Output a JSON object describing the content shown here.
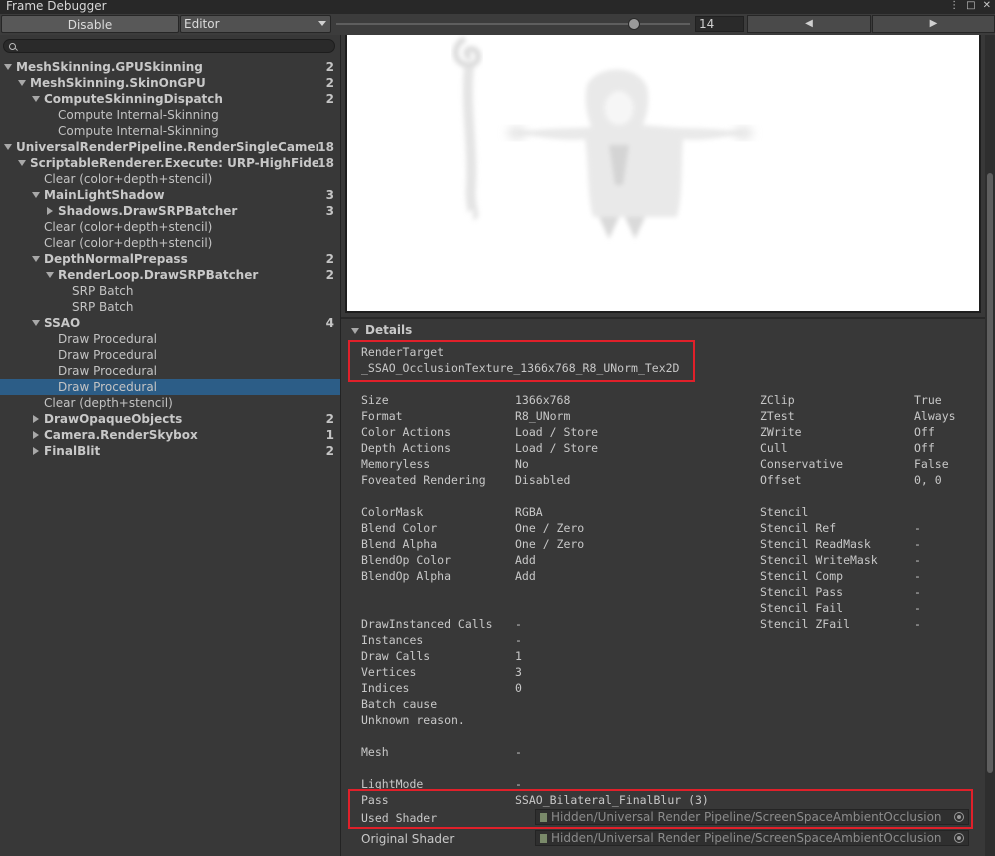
{
  "window": {
    "title": "Frame Debugger",
    "icons": [
      "more-icon",
      "maximize-icon",
      "close-icon"
    ]
  },
  "toolbar": {
    "disable_label": "Disable",
    "editor_label": "Editor",
    "step_value": "14",
    "step_level": 0.84,
    "prev_label": "◀",
    "next_label": "▶"
  },
  "tree": {
    "items": [
      {
        "label": "MeshSkinning.GPUSkinning",
        "count": "2",
        "depth": 0,
        "fold": "open",
        "bold": true
      },
      {
        "label": "MeshSkinning.SkinOnGPU",
        "count": "2",
        "depth": 1,
        "fold": "open",
        "bold": true
      },
      {
        "label": "ComputeSkinningDispatch",
        "count": "2",
        "depth": 2,
        "fold": "open",
        "bold": true
      },
      {
        "label": "Compute Internal-Skinning",
        "count": "",
        "depth": 3,
        "fold": "",
        "bold": false
      },
      {
        "label": "Compute Internal-Skinning",
        "count": "",
        "depth": 3,
        "fold": "",
        "bold": false
      },
      {
        "label": "UniversalRenderPipeline.RenderSingleCameraInterr",
        "count": "18",
        "depth": 0,
        "fold": "open",
        "bold": true
      },
      {
        "label": "ScriptableRenderer.Execute: URP-HighFidelity-R",
        "count": "18",
        "depth": 1,
        "fold": "open",
        "bold": true
      },
      {
        "label": "Clear (color+depth+stencil)",
        "count": "",
        "depth": 2,
        "fold": "",
        "bold": false
      },
      {
        "label": "MainLightShadow",
        "count": "3",
        "depth": 2,
        "fold": "open",
        "bold": true
      },
      {
        "label": "Shadows.DrawSRPBatcher",
        "count": "3",
        "depth": 3,
        "fold": "closed",
        "bold": true
      },
      {
        "label": "Clear (color+depth+stencil)",
        "count": "",
        "depth": 2,
        "fold": "",
        "bold": false
      },
      {
        "label": "Clear (color+depth+stencil)",
        "count": "",
        "depth": 2,
        "fold": "",
        "bold": false
      },
      {
        "label": "DepthNormalPrepass",
        "count": "2",
        "depth": 2,
        "fold": "open",
        "bold": true
      },
      {
        "label": "RenderLoop.DrawSRPBatcher",
        "count": "2",
        "depth": 3,
        "fold": "open",
        "bold": true
      },
      {
        "label": "SRP Batch",
        "count": "",
        "depth": 4,
        "fold": "",
        "bold": false
      },
      {
        "label": "SRP Batch",
        "count": "",
        "depth": 4,
        "fold": "",
        "bold": false
      },
      {
        "label": "SSAO",
        "count": "4",
        "depth": 2,
        "fold": "open",
        "bold": true
      },
      {
        "label": "Draw Procedural",
        "count": "",
        "depth": 3,
        "fold": "",
        "bold": false
      },
      {
        "label": "Draw Procedural",
        "count": "",
        "depth": 3,
        "fold": "",
        "bold": false
      },
      {
        "label": "Draw Procedural",
        "count": "",
        "depth": 3,
        "fold": "",
        "bold": false
      },
      {
        "label": "Draw Procedural",
        "count": "",
        "depth": 3,
        "fold": "",
        "bold": false,
        "selected": true
      },
      {
        "label": "Clear (depth+stencil)",
        "count": "",
        "depth": 2,
        "fold": "",
        "bold": false
      },
      {
        "label": "DrawOpaqueObjects",
        "count": "2",
        "depth": 2,
        "fold": "closed",
        "bold": true
      },
      {
        "label": "Camera.RenderSkybox",
        "count": "1",
        "depth": 2,
        "fold": "closed",
        "bold": true
      },
      {
        "label": "FinalBlit",
        "count": "2",
        "depth": 2,
        "fold": "closed",
        "bold": true
      }
    ]
  },
  "details": {
    "header": "Details",
    "render_target_label": "RenderTarget",
    "render_target_value": "_SSAO_OcclusionTexture_1366x768_R8_UNorm_Tex2D",
    "col1": [
      {
        "k": "Size",
        "v": "1366x768"
      },
      {
        "k": "Format",
        "v": "R8_UNorm"
      },
      {
        "k": "Color Actions",
        "v": "Load / Store"
      },
      {
        "k": "Depth Actions",
        "v": "Load / Store"
      },
      {
        "k": "Memoryless",
        "v": "No"
      },
      {
        "k": "Foveated Rendering",
        "v": "Disabled"
      },
      {
        "k": "",
        "v": ""
      },
      {
        "k": "ColorMask",
        "v": "RGBA"
      },
      {
        "k": "Blend Color",
        "v": "One / Zero"
      },
      {
        "k": "Blend Alpha",
        "v": "One / Zero"
      },
      {
        "k": "BlendOp Color",
        "v": "Add"
      },
      {
        "k": "BlendOp Alpha",
        "v": "Add"
      },
      {
        "k": "",
        "v": ""
      },
      {
        "k": "",
        "v": ""
      },
      {
        "k": "DrawInstanced Calls",
        "v": "-"
      },
      {
        "k": "Instances",
        "v": "-"
      },
      {
        "k": "Draw Calls",
        "v": "1"
      },
      {
        "k": "Vertices",
        "v": "3"
      },
      {
        "k": "Indices",
        "v": "0"
      }
    ],
    "col2": [
      {
        "k": "ZClip",
        "v": "True"
      },
      {
        "k": "ZTest",
        "v": "Always"
      },
      {
        "k": "ZWrite",
        "v": "Off"
      },
      {
        "k": "Cull",
        "v": "Off"
      },
      {
        "k": "Conservative",
        "v": "False"
      },
      {
        "k": "Offset",
        "v": "0, 0"
      },
      {
        "k": "",
        "v": ""
      },
      {
        "k": "Stencil",
        "v": ""
      },
      {
        "k": "Stencil Ref",
        "v": "-"
      },
      {
        "k": "Stencil ReadMask",
        "v": "-"
      },
      {
        "k": "Stencil WriteMask",
        "v": "-"
      },
      {
        "k": "Stencil Comp",
        "v": "-"
      },
      {
        "k": "Stencil Pass",
        "v": "-"
      },
      {
        "k": "Stencil Fail",
        "v": "-"
      },
      {
        "k": "Stencil ZFail",
        "v": "-"
      }
    ],
    "batch_cause_label": "Batch cause",
    "batch_cause_value": "Unknown reason.",
    "mesh_label": "Mesh",
    "mesh_value": "-",
    "lightmode_label": "LightMode",
    "lightmode_value": "-",
    "pass_label": "Pass",
    "pass_value": "SSAO_Bilateral_FinalBlur (3)",
    "used_shader_label": "Used Shader",
    "used_shader_value": "Hidden/Universal Render Pipeline/ScreenSpaceAmbientOcclusion",
    "original_shader_label": "Original Shader",
    "original_shader_value": "Hidden/Universal Render Pipeline/ScreenSpaceAmbientOcclusion"
  },
  "colors": {
    "highlight": "#e0202a",
    "selection": "#2c5d87"
  }
}
